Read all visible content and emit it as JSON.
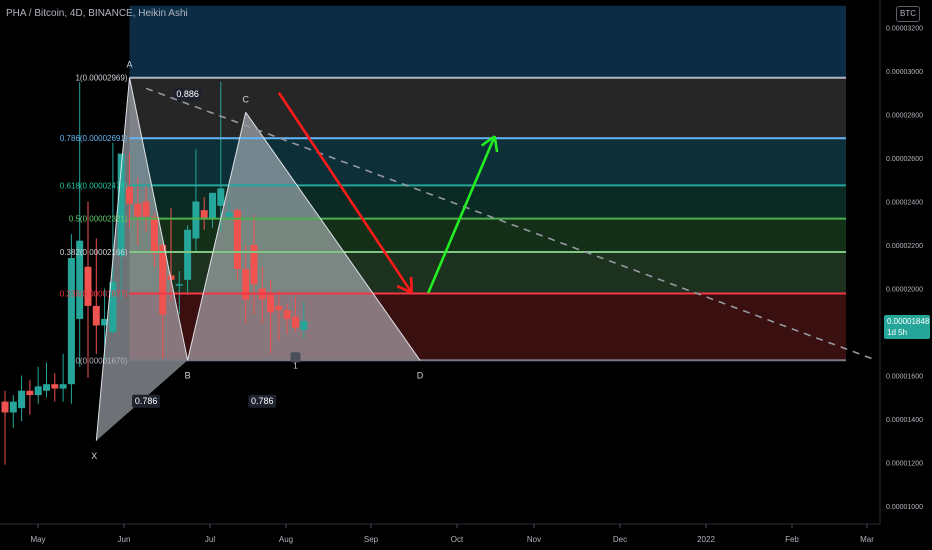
{
  "header": {
    "title": "PHA / Bitcoin, 4D, BINANCE, Heikin Ashi",
    "currency_badge": "BTC",
    "last_price": "0.00001848",
    "countdown": "1d 5h"
  },
  "colors": {
    "background": "#000000",
    "up_candle": "#26a69a",
    "down_candle": "#ef5350",
    "harmonic_fill": "#c8cdd6",
    "down_arrow": "#ff1a1a",
    "up_arrow": "#22ee22",
    "trendline": "#9598a1"
  },
  "chart_data": {
    "type": "candlestick",
    "title": "PHA / Bitcoin, 4D, BINANCE, Heikin Ashi",
    "x_axis": {
      "labels": [
        "May",
        "Jun",
        "Jul",
        "Aug",
        "Sep",
        "Oct",
        "Nov",
        "Dec",
        "2022",
        "Feb",
        "Mar"
      ]
    },
    "y_axis": {
      "ylim": [
        9e-07,
        3.3e-06
      ],
      "ticks": [
        {
          "value": 3.2e-06,
          "label": "0.00003200"
        },
        {
          "value": 3e-06,
          "label": "0.00003000"
        },
        {
          "value": 2.8e-06,
          "label": "0.00002800"
        },
        {
          "value": 2.6e-06,
          "label": "0.00002600"
        },
        {
          "value": 2.4e-06,
          "label": "0.00002400"
        },
        {
          "value": 2.2e-06,
          "label": "0.00002200"
        },
        {
          "value": 2e-06,
          "label": "0.00002000"
        },
        {
          "value": 1.8e-06,
          "label": "0.00001800"
        },
        {
          "value": 1.6e-06,
          "label": "0.00001600"
        },
        {
          "value": 1.4e-06,
          "label": "0.00001400"
        },
        {
          "value": 1.2e-06,
          "label": "0.00001200"
        },
        {
          "value": 1e-06,
          "label": "0.00001000"
        }
      ]
    },
    "candles": [
      {
        "o": 1.48,
        "h": 1.53,
        "l": 1.19,
        "c": 1.43
      },
      {
        "o": 1.43,
        "h": 1.51,
        "l": 1.36,
        "c": 1.48
      },
      {
        "o": 1.45,
        "h": 1.6,
        "l": 1.39,
        "c": 1.53
      },
      {
        "o": 1.53,
        "h": 1.58,
        "l": 1.42,
        "c": 1.51
      },
      {
        "o": 1.51,
        "h": 1.64,
        "l": 1.47,
        "c": 1.55
      },
      {
        "o": 1.53,
        "h": 1.66,
        "l": 1.5,
        "c": 1.56
      },
      {
        "o": 1.56,
        "h": 1.61,
        "l": 1.48,
        "c": 1.54
      },
      {
        "o": 1.54,
        "h": 1.7,
        "l": 1.48,
        "c": 1.56
      },
      {
        "o": 1.56,
        "h": 2.25,
        "l": 1.47,
        "c": 2.14
      },
      {
        "o": 1.86,
        "h": 2.95,
        "l": 1.64,
        "c": 2.22
      },
      {
        "o": 2.1,
        "h": 2.4,
        "l": 1.59,
        "c": 1.92
      },
      {
        "o": 1.92,
        "h": 2.23,
        "l": 1.7,
        "c": 1.83
      },
      {
        "o": 1.83,
        "h": 2.0,
        "l": 1.67,
        "c": 1.86
      },
      {
        "o": 1.8,
        "h": 2.67,
        "l": 1.79,
        "c": 2.03
      },
      {
        "o": 2.15,
        "h": 2.61,
        "l": 1.95,
        "c": 2.62
      },
      {
        "o": 2.47,
        "h": 2.62,
        "l": 2.28,
        "c": 2.39
      },
      {
        "o": 2.39,
        "h": 2.51,
        "l": 2.2,
        "c": 2.33
      },
      {
        "o": 2.4,
        "h": 2.48,
        "l": 2.26,
        "c": 2.33
      },
      {
        "o": 2.33,
        "h": 2.35,
        "l": 2.1,
        "c": 2.16
      },
      {
        "o": 2.2,
        "h": 2.21,
        "l": 1.68,
        "c": 1.88
      },
      {
        "o": 2.06,
        "h": 2.37,
        "l": 1.94,
        "c": 2.04
      },
      {
        "o": 2.02,
        "h": 2.08,
        "l": 1.88,
        "c": 2.02
      },
      {
        "o": 2.04,
        "h": 2.29,
        "l": 1.97,
        "c": 2.27
      },
      {
        "o": 2.23,
        "h": 2.64,
        "l": 2.17,
        "c": 2.4
      },
      {
        "o": 2.36,
        "h": 2.42,
        "l": 2.27,
        "c": 2.32
      },
      {
        "o": 2.32,
        "h": 2.43,
        "l": 2.28,
        "c": 2.44
      },
      {
        "o": 2.38,
        "h": 2.95,
        "l": 2.26,
        "c": 2.46
      },
      {
        "o": 2.33,
        "h": 2.4,
        "l": 2.32,
        "c": 2.35
      },
      {
        "o": 2.36,
        "h": 2.37,
        "l": 2.04,
        "c": 2.09
      },
      {
        "o": 2.09,
        "h": 2.2,
        "l": 1.84,
        "c": 1.95
      },
      {
        "o": 2.2,
        "h": 2.34,
        "l": 1.88,
        "c": 2.02
      },
      {
        "o": 2.0,
        "h": 2.1,
        "l": 1.84,
        "c": 1.95
      },
      {
        "o": 1.97,
        "h": 2.04,
        "l": 1.7,
        "c": 1.89
      },
      {
        "o": 1.92,
        "h": 1.99,
        "l": 1.76,
        "c": 1.9
      },
      {
        "o": 1.9,
        "h": 1.93,
        "l": 1.79,
        "c": 1.86
      },
      {
        "o": 1.87,
        "h": 1.96,
        "l": 1.8,
        "c": 1.82
      },
      {
        "o": 1.81,
        "h": 1.94,
        "l": 1.77,
        "c": 1.85
      }
    ],
    "fib_levels": [
      {
        "ratio": "1",
        "price": 2.969e-06,
        "label": "1(0.00002969)",
        "line_color": "#b2b5be",
        "label_color": "#d1d4dc"
      },
      {
        "ratio": "0.786",
        "price": 2.691e-06,
        "label": "0.786(0.00002691)",
        "line_color": "#64b5f6",
        "label_color": "#64b5f6"
      },
      {
        "ratio": "0.618",
        "price": 2.474e-06,
        "label": "0.618(0.00002474)",
        "line_color": "#26a69a",
        "label_color": "#26c6a0"
      },
      {
        "ratio": "0.5",
        "price": 2.321e-06,
        "label": "0.5(0.00002321)",
        "line_color": "#4caf50",
        "label_color": "#66d16a"
      },
      {
        "ratio": "0.382",
        "price": 2.168e-06,
        "label": "0.382(0.00002166)",
        "line_color": "#81c784",
        "label_color": "#d1d4dc"
      },
      {
        "ratio": "0.236",
        "price": 1.977e-06,
        "label": "0.236(0.00001977)",
        "line_color": "#f23645",
        "label_color": "#f23645"
      },
      {
        "ratio": "0",
        "price": 1.67e-06,
        "label": "0(0.00001670)",
        "line_color": "#787b86",
        "label_color": "#b2b5be"
      }
    ],
    "fib_zones": [
      {
        "top": 3.3e-06,
        "bottom": 2.969e-06,
        "color": "#0c2b45"
      },
      {
        "top": 2.969e-06,
        "bottom": 2.691e-06,
        "color": "#262626"
      },
      {
        "top": 2.691e-06,
        "bottom": 2.474e-06,
        "color": "#0c2f38"
      },
      {
        "top": 2.474e-06,
        "bottom": 2.321e-06,
        "color": "#0b2a24"
      },
      {
        "top": 2.321e-06,
        "bottom": 2.168e-06,
        "color": "#142f18"
      },
      {
        "top": 2.168e-06,
        "bottom": 1.977e-06,
        "color": "#1c321f"
      },
      {
        "top": 1.977e-06,
        "bottom": 1.67e-06,
        "color": "#3a0f10"
      }
    ],
    "harmonic_pattern": {
      "points": [
        {
          "name": "X",
          "bar": 11,
          "price": 1.3e-06
        },
        {
          "name": "A",
          "bar": 15,
          "price": 2.969e-06
        },
        {
          "name": "B",
          "bar": 22,
          "price": 1.67e-06
        },
        {
          "name": "C",
          "bar": 29,
          "price": 2.81e-06
        },
        {
          "name": "D",
          "bar": 50,
          "price": 1.67e-06
        }
      ],
      "ratio_labels": [
        {
          "text": "0.886",
          "bar": 22,
          "price": 2.88e-06
        },
        {
          "text": "0.786",
          "bar": 17,
          "price": 1.47e-06
        },
        {
          "text": "0.786",
          "bar": 31,
          "price": 1.47e-06
        }
      ]
    },
    "trendline": {
      "x1_bar": 17,
      "y1": 2.92e-06,
      "x2_bar": 105,
      "y2": 1.67e-06
    },
    "arrows": [
      {
        "name": "down",
        "x1_bar": 33,
        "y1": 2.9e-06,
        "x2_bar": 49,
        "y2": 1.98e-06
      },
      {
        "name": "up",
        "x1_bar": 51,
        "y1": 1.98e-06,
        "x2_bar": 59,
        "y2": 2.7e-06
      }
    ],
    "marker_text": "1"
  }
}
